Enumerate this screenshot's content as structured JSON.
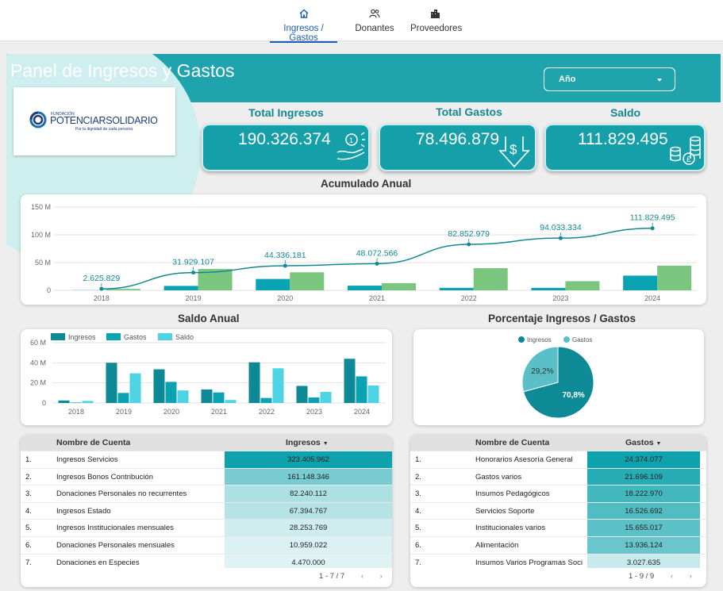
{
  "nav": {
    "tabs": [
      {
        "label": "Ingresos / Gastos",
        "icon": "home-icon",
        "active": true
      },
      {
        "label": "Donantes",
        "icon": "people-icon",
        "active": false
      },
      {
        "label": "Proveedores",
        "icon": "building-icon",
        "active": false
      }
    ]
  },
  "header": {
    "title": "Panel de Ingresos y Gastos",
    "year_select_label": "Año"
  },
  "logo": {
    "name": "POTENCIARSOLIDARIO",
    "tagline": "Por la dignidad de cada persona",
    "prefix": "FUNDACIÓN"
  },
  "kpis": [
    {
      "label": "Total Ingresos",
      "value": "190.326.374",
      "icon": "money-hand-icon"
    },
    {
      "label": "Total Gastos",
      "value": "78.496.879",
      "icon": "money-down-arrow-icon"
    },
    {
      "label": "Saldo",
      "value": "111.829.495",
      "icon": "coins-stack-icon"
    }
  ],
  "colors": {
    "teal": "#1fa3ad",
    "dark_teal": "#138893",
    "ingresos": "#0e8a96",
    "gastos": "#0aa3b3",
    "saldo": "#4dd3e3",
    "green": "#7bc67e"
  },
  "chart_data": [
    {
      "type": "bar",
      "title": "Acumulado Anual",
      "categories": [
        "2018",
        "2019",
        "2020",
        "2021",
        "2022",
        "2023",
        "2024"
      ],
      "series": [
        {
          "name": "",
          "type": "bar",
          "values": [
            0.3,
            8,
            20.5,
            8.5,
            4.5,
            4.5,
            26.5
          ]
        },
        {
          "name": "",
          "type": "bar",
          "values": [
            2.6,
            38.5,
            32.5,
            13,
            40,
            16.5,
            44.5
          ]
        },
        {
          "name": "",
          "type": "line",
          "values": [
            2625829,
            31929107,
            44336181,
            48072566,
            82852979,
            94033334,
            111829495
          ]
        }
      ],
      "line_labels": [
        "2.625.829",
        "31.929.107",
        "44.336.181",
        "48.072.566",
        "82.852.979",
        "94.033.334",
        "111.829.495"
      ],
      "y_ticks": [
        "0",
        "50 M",
        "100 M",
        "150 M"
      ],
      "ylim": [
        0,
        150
      ]
    },
    {
      "type": "bar",
      "title": "Saldo Anual",
      "categories": [
        "2018",
        "2019",
        "2020",
        "2021",
        "2022",
        "2023",
        "2024"
      ],
      "series": [
        {
          "name": "Ingresos",
          "values": [
            2.5,
            40,
            33.5,
            13.5,
            40.5,
            17,
            44
          ]
        },
        {
          "name": "Gastos",
          "values": [
            0.5,
            10,
            21,
            10.5,
            5,
            5.5,
            26.5
          ]
        },
        {
          "name": "Saldo",
          "values": [
            2,
            29.5,
            12.5,
            3,
            34.5,
            11,
            17.5
          ]
        }
      ],
      "y_ticks": [
        "0",
        "20 M",
        "40 M",
        "60 M"
      ],
      "ylim": [
        0,
        60
      ],
      "legend": "top-left"
    },
    {
      "type": "pie",
      "title": "Porcentaje Ingresos / Gastos",
      "categories": [
        "Ingresos",
        "Gastos"
      ],
      "values": [
        70.8,
        29.2
      ],
      "labels": [
        "70,8%",
        "29,2%"
      ],
      "legend": "top"
    }
  ],
  "table_ingresos": {
    "col_name": "Nombre de Cuenta",
    "col_value": "Ingresos",
    "rows": [
      {
        "n": "1.",
        "name": "Ingresos Servicios",
        "value": "323.405.962",
        "frac": 1.0
      },
      {
        "n": "2.",
        "name": "Ingresos Bonos Contribución",
        "value": "161.148.346",
        "frac": 0.5
      },
      {
        "n": "3.",
        "name": "Donaciones Personales no recurrentes",
        "value": "82.240.112",
        "frac": 0.25
      },
      {
        "n": "4.",
        "name": "Ingresos Estado",
        "value": "67.394.767",
        "frac": 0.21
      },
      {
        "n": "5.",
        "name": "Ingresos Institucionales mensuales",
        "value": "28.253.769",
        "frac": 0.09
      },
      {
        "n": "6.",
        "name": "Donaciones Personales mensuales",
        "value": "10.959.022",
        "frac": 0.03
      },
      {
        "n": "7.",
        "name": "Donaciones en Especies",
        "value": "4.470.000",
        "frac": 0.01
      }
    ],
    "pager": "1 - 7 / 7"
  },
  "table_gastos": {
    "col_name": "Nombre de Cuenta",
    "col_value": "Gastos",
    "rows": [
      {
        "n": "1.",
        "name": "Honorarios Asesoría General",
        "value": "24.374.077",
        "frac": 1.0
      },
      {
        "n": "2.",
        "name": "Gastos varios",
        "value": "21.696.109",
        "frac": 0.89
      },
      {
        "n": "3.",
        "name": "Insumos Pedagógicos",
        "value": "18.222.970",
        "frac": 0.75
      },
      {
        "n": "4.",
        "name": "Servicios Soporte",
        "value": "16.526.692",
        "frac": 0.68
      },
      {
        "n": "5.",
        "name": "Institucionales varios",
        "value": "15.655.017",
        "frac": 0.64
      },
      {
        "n": "6.",
        "name": "Alimentación",
        "value": "13.936.124",
        "frac": 0.57
      },
      {
        "n": "7.",
        "name": "Insumos Varios Programas Soci...",
        "value": "3.027.635",
        "frac": 0.12
      }
    ],
    "pager": "1 - 9 / 9"
  }
}
